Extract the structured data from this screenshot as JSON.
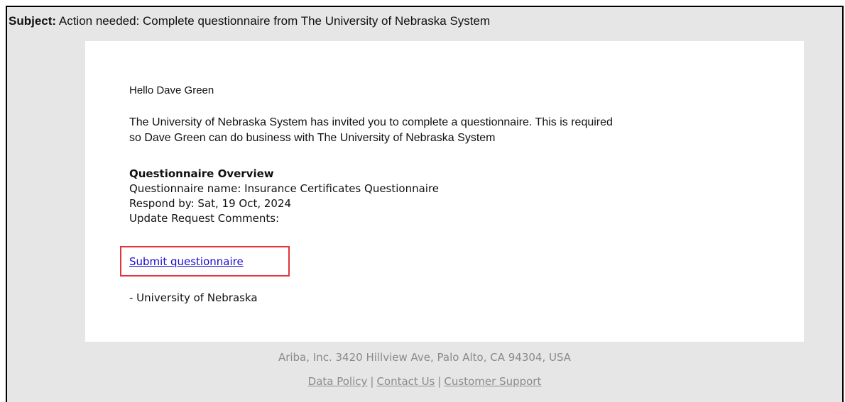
{
  "email": {
    "subject_label": "Subject:",
    "subject": "Action needed: Complete questionnaire from The University of Nebraska System",
    "greeting": "Hello Dave Green",
    "intro_line1": "The University of Nebraska System has invited you to complete a questionnaire. This is required",
    "intro_line2": "so Dave Green can do business with The University of Nebraska System",
    "overview": {
      "heading": "Questionnaire Overview",
      "name_line": "Questionnaire name: Insurance Certificates Questionnaire",
      "respond_line": "Respond by: Sat, 19 Oct, 2024",
      "comments_line": "Update Request Comments:"
    },
    "submit_label": "Submit questionnaire",
    "signoff": "- University of Nebraska"
  },
  "footer": {
    "address": "Ariba, Inc. 3420 Hillview Ave, Palo Alto, CA 94304, USA",
    "links": [
      "Data Policy",
      "Contact Us",
      "Customer Support"
    ],
    "separator": "|"
  },
  "colors": {
    "frame_bg": "#e6e6e6",
    "link": "#1a0dcc",
    "highlight_box": "#e0353b",
    "footer_text": "#8a8a8a"
  }
}
